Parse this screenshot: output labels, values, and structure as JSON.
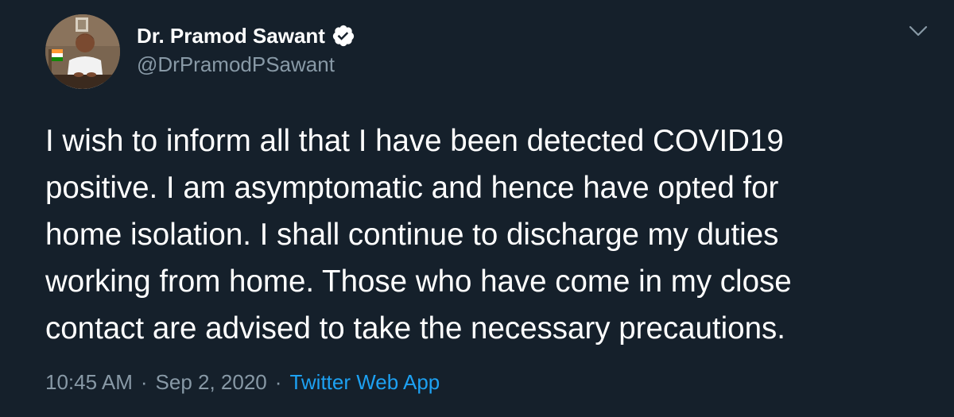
{
  "tweet": {
    "author": {
      "display_name": "Dr. Pramod Sawant",
      "handle": "@DrPramodPSawant",
      "verified": true
    },
    "text_lines": [
      "I wish to inform all that I have been detected COVID19",
      "positive. I am asymptomatic and hence have opted for",
      "home isolation. I shall continue to discharge my duties",
      "working from home. Those who have come in my close",
      "contact are advised to take the necessary precautions."
    ],
    "time": "10:45 AM",
    "date": "Sep 2, 2020",
    "separator": "·",
    "source": "Twitter Web App",
    "icons": {
      "verified": "verified-badge-icon",
      "menu": "chevron-down-icon"
    },
    "colors": {
      "background": "#15202b",
      "primary_text": "#ffffff",
      "secondary_text": "#8899a6",
      "accent": "#1da1f2"
    }
  }
}
